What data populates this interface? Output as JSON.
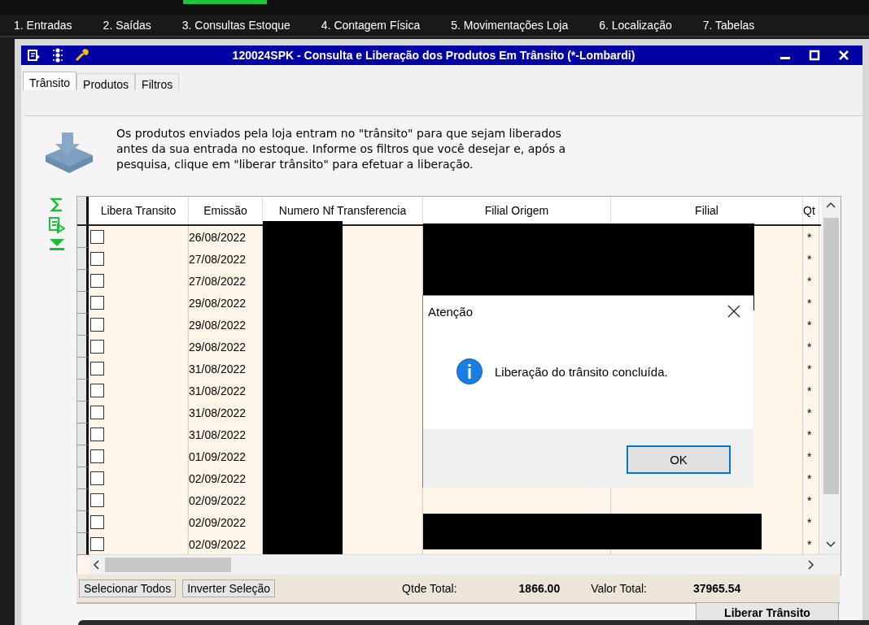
{
  "menu": [
    "1. Entradas",
    "2. Saídas",
    "3. Consultas Estoque",
    "4. Contagem Física",
    "5. Movimentações Loja",
    "6. Localização",
    "7. Tabelas"
  ],
  "window": {
    "title": "120024SPK - Consulta e Liberação dos Produtos Em Trânsito (*-Lombardi)"
  },
  "tabs": [
    {
      "label": "Trânsito",
      "selected": true
    },
    {
      "label": "Produtos",
      "selected": false
    },
    {
      "label": "Filtros",
      "selected": false
    }
  ],
  "description": "Os produtos enviados pela loja entram no \"trânsito\" para que sejam liberados antes da sua entrada no estoque. Informe os filtros que você desejar e, após a pesquisa, clique em \"liberar trânsito\" para efetuar a liberação.",
  "table": {
    "columns": [
      "Libera Transito",
      "Emissão",
      "Numero Nf Transferencia",
      "Filial Origem",
      "Filial",
      "Qt"
    ],
    "rows": [
      {
        "checked": false,
        "emissao": "26/08/2022",
        "qt": "*"
      },
      {
        "checked": false,
        "emissao": "27/08/2022",
        "qt": "*"
      },
      {
        "checked": false,
        "emissao": "27/08/2022",
        "qt": "*"
      },
      {
        "checked": false,
        "emissao": "29/08/2022",
        "qt": "*"
      },
      {
        "checked": false,
        "emissao": "29/08/2022",
        "qt": "*"
      },
      {
        "checked": false,
        "emissao": "29/08/2022",
        "qt": "*"
      },
      {
        "checked": false,
        "emissao": "31/08/2022",
        "qt": "*"
      },
      {
        "checked": false,
        "emissao": "31/08/2022",
        "qt": "*"
      },
      {
        "checked": false,
        "emissao": "31/08/2022",
        "qt": "*"
      },
      {
        "checked": false,
        "emissao": "31/08/2022",
        "qt": "*"
      },
      {
        "checked": false,
        "emissao": "01/09/2022",
        "qt": "*"
      },
      {
        "checked": false,
        "emissao": "02/09/2022",
        "qt": "*"
      },
      {
        "checked": false,
        "emissao": "02/09/2022",
        "qt": "*"
      },
      {
        "checked": false,
        "emissao": "02/09/2022",
        "qt": "*"
      },
      {
        "checked": false,
        "emissao": "02/09/2022",
        "qt": "*"
      }
    ]
  },
  "footer": {
    "buttons": [
      "Selecionar Todos",
      "Inverter Seleção"
    ],
    "qtde_label": "Qtde Total:",
    "qtde_value": "1866.00",
    "valor_label": "Valor Total:",
    "valor_value": "37965.54"
  },
  "action_button": "Liberar Trânsito",
  "dialog": {
    "title": "Atenção",
    "message": "Liberação do trânsito concluída.",
    "button": "OK"
  }
}
